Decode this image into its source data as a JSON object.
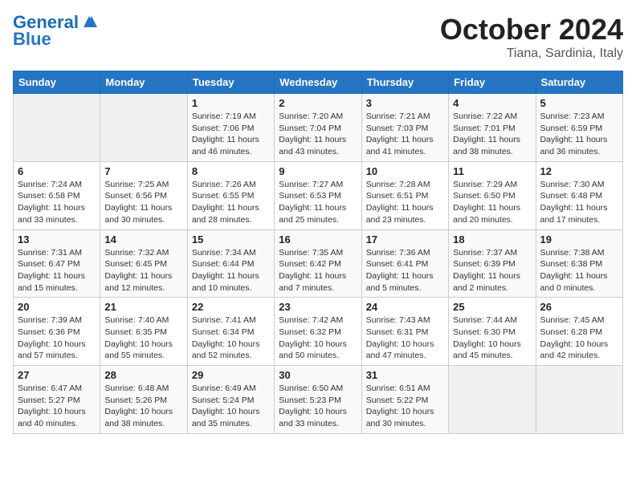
{
  "logo": {
    "line1": "General",
    "line2": "Blue"
  },
  "title": "October 2024",
  "subtitle": "Tiana, Sardinia, Italy",
  "headers": [
    "Sunday",
    "Monday",
    "Tuesday",
    "Wednesday",
    "Thursday",
    "Friday",
    "Saturday"
  ],
  "weeks": [
    [
      {
        "day": "",
        "info": ""
      },
      {
        "day": "",
        "info": ""
      },
      {
        "day": "1",
        "info": "Sunrise: 7:19 AM\nSunset: 7:06 PM\nDaylight: 11 hours and 46 minutes."
      },
      {
        "day": "2",
        "info": "Sunrise: 7:20 AM\nSunset: 7:04 PM\nDaylight: 11 hours and 43 minutes."
      },
      {
        "day": "3",
        "info": "Sunrise: 7:21 AM\nSunset: 7:03 PM\nDaylight: 11 hours and 41 minutes."
      },
      {
        "day": "4",
        "info": "Sunrise: 7:22 AM\nSunset: 7:01 PM\nDaylight: 11 hours and 38 minutes."
      },
      {
        "day": "5",
        "info": "Sunrise: 7:23 AM\nSunset: 6:59 PM\nDaylight: 11 hours and 36 minutes."
      }
    ],
    [
      {
        "day": "6",
        "info": "Sunrise: 7:24 AM\nSunset: 6:58 PM\nDaylight: 11 hours and 33 minutes."
      },
      {
        "day": "7",
        "info": "Sunrise: 7:25 AM\nSunset: 6:56 PM\nDaylight: 11 hours and 30 minutes."
      },
      {
        "day": "8",
        "info": "Sunrise: 7:26 AM\nSunset: 6:55 PM\nDaylight: 11 hours and 28 minutes."
      },
      {
        "day": "9",
        "info": "Sunrise: 7:27 AM\nSunset: 6:53 PM\nDaylight: 11 hours and 25 minutes."
      },
      {
        "day": "10",
        "info": "Sunrise: 7:28 AM\nSunset: 6:51 PM\nDaylight: 11 hours and 23 minutes."
      },
      {
        "day": "11",
        "info": "Sunrise: 7:29 AM\nSunset: 6:50 PM\nDaylight: 11 hours and 20 minutes."
      },
      {
        "day": "12",
        "info": "Sunrise: 7:30 AM\nSunset: 6:48 PM\nDaylight: 11 hours and 17 minutes."
      }
    ],
    [
      {
        "day": "13",
        "info": "Sunrise: 7:31 AM\nSunset: 6:47 PM\nDaylight: 11 hours and 15 minutes."
      },
      {
        "day": "14",
        "info": "Sunrise: 7:32 AM\nSunset: 6:45 PM\nDaylight: 11 hours and 12 minutes."
      },
      {
        "day": "15",
        "info": "Sunrise: 7:34 AM\nSunset: 6:44 PM\nDaylight: 11 hours and 10 minutes."
      },
      {
        "day": "16",
        "info": "Sunrise: 7:35 AM\nSunset: 6:42 PM\nDaylight: 11 hours and 7 minutes."
      },
      {
        "day": "17",
        "info": "Sunrise: 7:36 AM\nSunset: 6:41 PM\nDaylight: 11 hours and 5 minutes."
      },
      {
        "day": "18",
        "info": "Sunrise: 7:37 AM\nSunset: 6:39 PM\nDaylight: 11 hours and 2 minutes."
      },
      {
        "day": "19",
        "info": "Sunrise: 7:38 AM\nSunset: 6:38 PM\nDaylight: 11 hours and 0 minutes."
      }
    ],
    [
      {
        "day": "20",
        "info": "Sunrise: 7:39 AM\nSunset: 6:36 PM\nDaylight: 10 hours and 57 minutes."
      },
      {
        "day": "21",
        "info": "Sunrise: 7:40 AM\nSunset: 6:35 PM\nDaylight: 10 hours and 55 minutes."
      },
      {
        "day": "22",
        "info": "Sunrise: 7:41 AM\nSunset: 6:34 PM\nDaylight: 10 hours and 52 minutes."
      },
      {
        "day": "23",
        "info": "Sunrise: 7:42 AM\nSunset: 6:32 PM\nDaylight: 10 hours and 50 minutes."
      },
      {
        "day": "24",
        "info": "Sunrise: 7:43 AM\nSunset: 6:31 PM\nDaylight: 10 hours and 47 minutes."
      },
      {
        "day": "25",
        "info": "Sunrise: 7:44 AM\nSunset: 6:30 PM\nDaylight: 10 hours and 45 minutes."
      },
      {
        "day": "26",
        "info": "Sunrise: 7:45 AM\nSunset: 6:28 PM\nDaylight: 10 hours and 42 minutes."
      }
    ],
    [
      {
        "day": "27",
        "info": "Sunrise: 6:47 AM\nSunset: 5:27 PM\nDaylight: 10 hours and 40 minutes."
      },
      {
        "day": "28",
        "info": "Sunrise: 6:48 AM\nSunset: 5:26 PM\nDaylight: 10 hours and 38 minutes."
      },
      {
        "day": "29",
        "info": "Sunrise: 6:49 AM\nSunset: 5:24 PM\nDaylight: 10 hours and 35 minutes."
      },
      {
        "day": "30",
        "info": "Sunrise: 6:50 AM\nSunset: 5:23 PM\nDaylight: 10 hours and 33 minutes."
      },
      {
        "day": "31",
        "info": "Sunrise: 6:51 AM\nSunset: 5:22 PM\nDaylight: 10 hours and 30 minutes."
      },
      {
        "day": "",
        "info": ""
      },
      {
        "day": "",
        "info": ""
      }
    ]
  ]
}
